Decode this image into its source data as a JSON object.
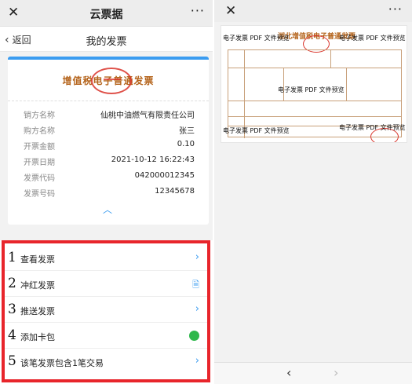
{
  "left": {
    "topbar": {
      "close_icon": "close-icon",
      "title": "云票据",
      "more_icon": "more-icon"
    },
    "navbar": {
      "back_label": "返回",
      "title": "我的发票"
    },
    "invoice": {
      "title": "增值税电子普通发票",
      "fields": [
        {
          "key": "销方名称",
          "value": "仙桃中油燃气有限责任公司"
        },
        {
          "key": "购方名称",
          "value": "张三"
        },
        {
          "key": "开票金额",
          "value": "0.10"
        },
        {
          "key": "开票日期",
          "value": "2021-10-12 16:22:43"
        },
        {
          "key": "发票代码",
          "value": "042000012345"
        },
        {
          "key": "发票号码",
          "value": "12345678"
        }
      ]
    },
    "menu": [
      {
        "num": "1",
        "label": "查看发票",
        "icon": "chevron-right-icon"
      },
      {
        "num": "2",
        "label": "冲红发票",
        "icon": "document-icon"
      },
      {
        "num": "3",
        "label": "推送发票",
        "icon": "chevron-right-icon"
      },
      {
        "num": "4",
        "label": "添加卡包",
        "icon": "wechat-icon"
      },
      {
        "num": "5",
        "label": "该笔发票包含1笔交易",
        "icon": "chevron-right-icon"
      }
    ]
  },
  "right": {
    "doc_title": "湖北增值税电子普通发票",
    "watermark": "电子发票 PDF 文件预览",
    "footer": {
      "back_icon": "chevron-left-icon",
      "forward_icon": "chevron-right-icon"
    }
  },
  "colors": {
    "accent": "#3b9cf0",
    "highlight_box": "#e8252b",
    "seal": "#d9342b"
  }
}
